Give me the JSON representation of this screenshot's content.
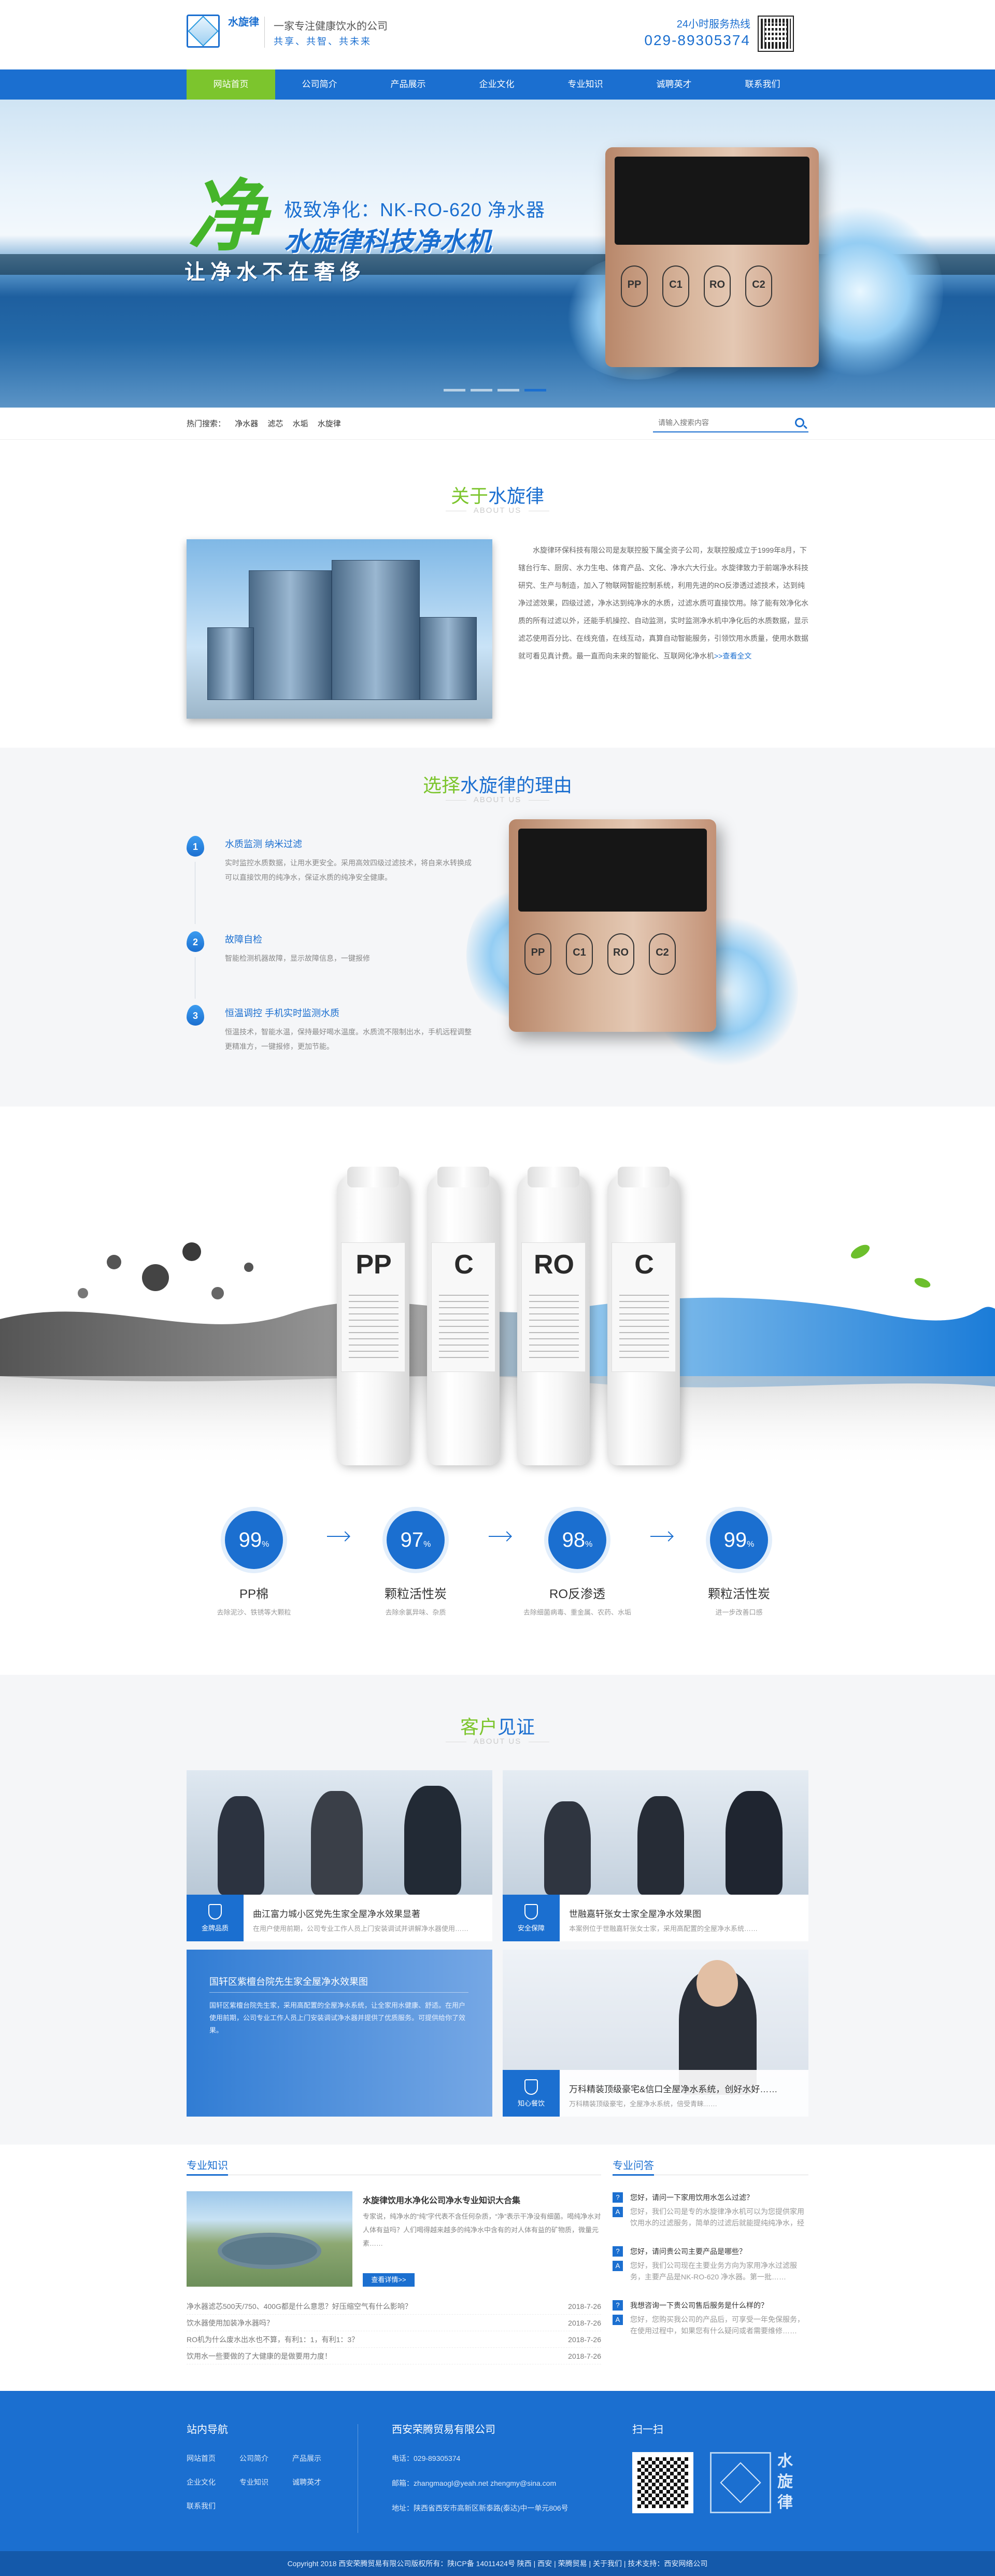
{
  "header": {
    "logo_text": "水旋律",
    "slogan1": "一家专注健康饮水的公司",
    "slogan2": "共享、共智、共未来",
    "hotline_label": "24小时服务热线",
    "hotline": "029-89305374"
  },
  "nav": [
    "网站首页",
    "公司简介",
    "产品展示",
    "企业文化",
    "专业知识",
    "诚聘英才",
    "联系我们"
  ],
  "banner": {
    "big_char": "净",
    "subtitle": "极致净化：NK-RO-620 净水器",
    "title": "水旋律科技净水机",
    "tagline": "让净水不在奢侈",
    "filter_labels": [
      "PP",
      "C1",
      "RO",
      "C2"
    ]
  },
  "search": {
    "label": "热门搜索：",
    "keywords": [
      "净水器",
      "滤芯",
      "水垢",
      "水旋律"
    ],
    "placeholder": "请输入搜索内容"
  },
  "about": {
    "title_a": "关于",
    "title_b": "水旋律",
    "sub": "ABOUT US",
    "text": "水旋律环保科技有限公司是友联控股下属全资子公司，友联控股成立于1999年8月，下辖台行车、厨房、水力生电、体育产品、文化、净水六大行业。水旋律致力于前端净水科技研究、生产与制造，加入了物联网智能控制系统，利用先进的RO反渗透过滤技术，达到纯净过滤效果，四级过滤，净水达到纯净水的水质，过滤水质可直接饮用。除了能有效净化水质的所有过滤以外，还能手机操控、自动监测，实时监测净水机中净化后的水质数据，显示滤芯使用百分比、在线充值，在线互动，真算自动智能服务，引领饮用水质量，使用水数据就可看见真计费。最一直而向未来的智能化、互联网化净水机",
    "more": ">>查看全文"
  },
  "reason": {
    "title_a": "选择",
    "title_b": "水旋律的理由",
    "sub": "ABOUT US",
    "items": [
      {
        "num": "1",
        "title": "水质监测 纳米过滤",
        "desc": "实时监控水质数据，让用水更安全。采用高效四级过滤技术，将自来水转换成可以直接饮用的纯净水，保证水质的纯净安全健康。"
      },
      {
        "num": "2",
        "title": "故障自检",
        "desc": "智能检测机器故障，显示故障信息，一键报修"
      },
      {
        "num": "3",
        "title": "恒温调控 手机实时监测水质",
        "desc": "恒温技术，智能水温，保持最好喝水温度。水质流不限制出水，手机远程调整更精准方，一键报修，更加节能。"
      }
    ]
  },
  "filters": {
    "cartridges": [
      "PP",
      "C",
      "RO",
      "C"
    ],
    "steps": [
      {
        "pct": "99",
        "name": "PP棉",
        "desc": "去除泥沙、铁锈等大颗粒"
      },
      {
        "pct": "97",
        "name": "颗粒活性炭",
        "desc": "去除余氯异味、杂质"
      },
      {
        "pct": "98",
        "name": "RO反渗透",
        "desc": "去除细菌病毒、重金属、农药、水垢"
      },
      {
        "pct": "99",
        "name": "颗粒活性炭",
        "desc": "进一步改善口感"
      }
    ]
  },
  "cases": {
    "title_a": "客户",
    "title_b": "见证",
    "sub": "ABOUT US",
    "items": [
      {
        "icon_label": "金牌品质",
        "title": "曲江富力城小区党先生家全屋净水效果显著",
        "desc": "在用户使用前期，公司专业工作人员上门安装调试并讲解净水器使用……"
      },
      {
        "icon_label": "安全保障",
        "title": "世融嘉轩张女士家全屋净水效果图",
        "desc": "本案例位于世融嘉轩张女士家，采用高配置的全屋净水系统……"
      },
      {
        "icon_label": "",
        "title": "国轩区紫檀台院先生家全屋净水效果图",
        "desc": "国轩区紫檀台院先生家，采用高配置的全屋净水系统，让全家用水健康、舒适。在用户使用前期，公司专业工作人员上门安装调试净水器并提供了优质服务。可提供给你了效果。"
      },
      {
        "icon_label": "知心餐饮",
        "title": "万科精装顶级豪宅&信口全屋净水系统，创好水好……",
        "desc": "万科精装顶级豪宅，全屋净水系统，倍受青睐……"
      }
    ]
  },
  "knowledge": {
    "heading": "专业知识",
    "feature_title": "水旋律饮用水净化公司净水专业知识大合集",
    "feature_desc": "专家说，纯净水的“纯”字代表不含任何杂质，“净”表示干净没有细菌。喝纯净水对人体有益吗？人们喝得越来越多的纯净水中含有的对人体有益的矿物质，微量元素……",
    "btn": "查看详情>>",
    "list": [
      {
        "t": "净水器滤芯500天/750、400G都是什么意思？好压缩空气有什么影响？",
        "d": "2018-7-26"
      },
      {
        "t": "饮水器使用加装净水器吗？",
        "d": "2018-7-26"
      },
      {
        "t": "RO机为什么废水出水也不算，有利1：1，有利1：3？",
        "d": "2018-7-26"
      },
      {
        "t": "饮用水一些要做的了大健康的是做要用力度！",
        "d": "2018-7-26"
      }
    ],
    "qa_heading": "专业问答",
    "qa": [
      {
        "q": "您好，请问一下家用饮用水怎么过滤？",
        "a": "您好，我们公司是专的水旋律净水机可以为您提供家用饮用水的过滤服务，简单的过滤后就能提纯纯净水，经过简单的过滤后就能提纯的……"
      },
      {
        "q": "您好，请问贵公司主要产品是哪些？",
        "a": "您好，我们公司现在主要业务方向为家用净水过滤服务，主要产品是NK-RO-620 净水器。第一批……"
      },
      {
        "q": "我想咨询一下贵公司售后服务是什么样的？",
        "a": "您好，您购买我公司的产品后，可享受一年免保服务，在使用过程中，如果您有什么疑问或者需要维修……"
      }
    ]
  },
  "footer": {
    "nav_heading": "站内导航",
    "nav_links": [
      "网站首页",
      "公司简介",
      "产品展示",
      "企业文化",
      "专业知识",
      "诚聘英才",
      "联系我们"
    ],
    "company": "西安荣腾贸易有限公司",
    "phone": "电话：029-89305374",
    "email": "邮箱：zhangmaogl@yeah.net  zhengmy@sina.com",
    "address": "地址：陕西省西安市高新区新泰路(泰达)中一单元806号",
    "scan": "扫一扫",
    "logo_text": "水旋律",
    "copyright": "Copyright  2018 西安荣腾贸易有限公司版权所有：陕ICP备 14011424号   陕西 | 西安 | 荣腾贸易 | 关于我们 | 技术支持：西安网络公司"
  }
}
